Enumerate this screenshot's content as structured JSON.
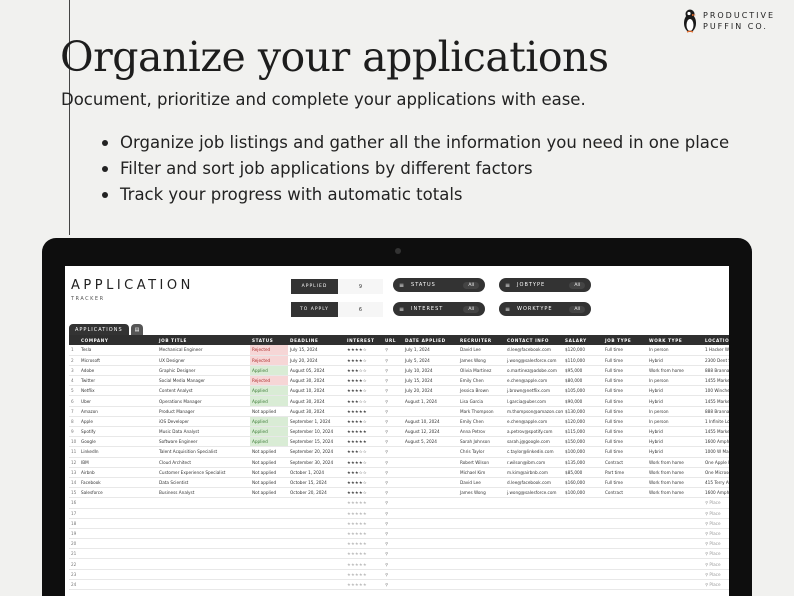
{
  "brand": {
    "line1": "PRODUCTIVE",
    "line2": "PUFFIN CO."
  },
  "headline": "Organize your applications",
  "subline": "Document, prioritize and complete your applications with ease.",
  "bullets": [
    "Organize job listings and gather all the information you need in one place",
    "Filter and sort job applications by different factors",
    "Track your progress with automatic totals"
  ],
  "app": {
    "title": "APPLICATION",
    "subtitle": "TRACKER",
    "stats": [
      {
        "label": "APPLIED",
        "value": "9"
      },
      {
        "label": "TO APPLY",
        "value": "6"
      }
    ],
    "filters": [
      {
        "label": "STATUS",
        "value": "All"
      },
      {
        "label": "JOBTYPE",
        "value": "All"
      },
      {
        "label": "INTEREST",
        "value": "All"
      },
      {
        "label": "WORKTYPE",
        "value": "All"
      }
    ],
    "tab": "APPLICATIONS",
    "columns": [
      "COMPANY",
      "JOB TITLE",
      "STATUS",
      "DEADLINE",
      "INTEREST",
      "URL",
      "DATE APPLIED",
      "RECRUITER",
      "CONTACT INFO",
      "SALARY",
      "JOB TYPE",
      "WORK TYPE",
      "LOCATION"
    ],
    "rows": [
      [
        "1",
        "Tesla",
        "Mechanical Engineer",
        "Rejected",
        "July 15, 2024",
        "★★★★☆",
        "July 1, 2024",
        "David Lee",
        "d.lee@facebook.com",
        "$120,000",
        "Full time",
        "In person",
        "1 Hacker Way"
      ],
      [
        "2",
        "Microsoft",
        "UX Designer",
        "Rejected",
        "July 20, 2024",
        "★★★★☆",
        "July 5, 2024",
        "James Wong",
        "j.wong@salesforce.com",
        "$110,000",
        "Full time",
        "Hybrid",
        "2300 Dent St"
      ],
      [
        "3",
        "Adobe",
        "Graphic Designer",
        "Applied",
        "August 05, 2024",
        "★★★☆☆",
        "July 10, 2024",
        "Olivia Martinez",
        "o.martinez@adobe.com",
        "$95,000",
        "Full time",
        "Work from home",
        "888 Brannan"
      ],
      [
        "4",
        "Twitter",
        "Social Media Manager",
        "Rejected",
        "August 30, 2024",
        "★★★★☆",
        "July 15, 2024",
        "Emily Chen",
        "e.chen@apple.com",
        "$80,000",
        "Full time",
        "In person",
        "1455 Market"
      ],
      [
        "5",
        "Netflix",
        "Content Analyst",
        "Applied",
        "August 10, 2024",
        "★★★★☆",
        "July 20, 2024",
        "Jessica Brown",
        "j.brown@netflix.com",
        "$105,000",
        "Full time",
        "Hybrid",
        "100 Winches"
      ],
      [
        "6",
        "Uber",
        "Operations Manager",
        "Applied",
        "August 30, 2024",
        "★★★☆☆",
        "August 1, 2024",
        "Lisa Garcia",
        "l.garcia@uber.com",
        "$90,000",
        "Full time",
        "Hybrid",
        "1455 Market"
      ],
      [
        "7",
        "Amazon",
        "Product Manager",
        "Not applied",
        "August 30, 2024",
        "★★★★★",
        "",
        "Mark Thompson",
        "m.thompson@amazon.com",
        "$130,000",
        "Full time",
        "In person",
        "888 Brannan"
      ],
      [
        "8",
        "Apple",
        "iOS Developer",
        "Applied",
        "September 1, 2024",
        "★★★★☆",
        "August 10, 2024",
        "Emily Chen",
        "e.chen@apple.com",
        "$120,000",
        "Full time",
        "In person",
        "1 Infinite Lo"
      ],
      [
        "9",
        "Spotify",
        "Music Data Analyst",
        "Applied",
        "September 10, 2024",
        "★★★★★",
        "August 12, 2024",
        "Anna Petrov",
        "a.petrov@spotify.com",
        "$115,000",
        "Full time",
        "Hybrid",
        "1455 Market"
      ],
      [
        "10",
        "Google",
        "Software Engineer",
        "Applied",
        "September 15, 2024",
        "★★★★★",
        "August 5, 2024",
        "Sarah Johnson",
        "sarah.j@google.com",
        "$150,000",
        "Full time",
        "Hybrid",
        "1600 Amphit"
      ],
      [
        "11",
        "LinkedIn",
        "Talent Acquisition Specialist",
        "Not applied",
        "September 20, 2024",
        "★★★☆☆",
        "",
        "Chris Taylor",
        "c.taylor@linkedin.com",
        "$100,000",
        "Full time",
        "Hybrid",
        "1000 W Maud"
      ],
      [
        "12",
        "IBM",
        "Cloud Architect",
        "Not applied",
        "September 30, 2024",
        "★★★★☆",
        "",
        "Robert Wilson",
        "r.wilson@ibm.com",
        "$135,000",
        "Contract",
        "Work from home",
        "One Apple P"
      ],
      [
        "13",
        "Airbnb",
        "Customer Experience Specialist",
        "Not applied",
        "October 1, 2024",
        "★★★☆☆",
        "",
        "Michael Kim",
        "m.kim@airbnb.com",
        "$85,000",
        "Part time",
        "Work from home",
        "One Microso"
      ],
      [
        "14",
        "Facebook",
        "Data Scientist",
        "Not applied",
        "October 15, 2024",
        "★★★★☆",
        "",
        "David Lee",
        "d.lee@facebook.com",
        "$160,000",
        "Full time",
        "Work from home",
        "415 Terry Av"
      ],
      [
        "15",
        "Salesforce",
        "Business Analyst",
        "Not applied",
        "October 20, 2024",
        "★★★★☆",
        "",
        "James Wong",
        "j.wong@salesforce.com",
        "$100,000",
        "Contract",
        "Work from home",
        "1600 Amphit"
      ]
    ],
    "empty_rows": [
      "16",
      "17",
      "18",
      "19",
      "20",
      "21",
      "22",
      "23",
      "24"
    ],
    "empty_location": "Place"
  }
}
